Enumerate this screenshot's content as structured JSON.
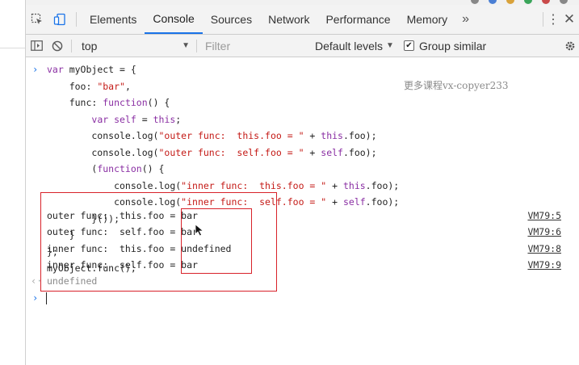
{
  "devtools": {
    "tabs": [
      {
        "label": "Elements",
        "active": false
      },
      {
        "label": "Console",
        "active": true
      },
      {
        "label": "Sources",
        "active": false
      },
      {
        "label": "Network",
        "active": false
      },
      {
        "label": "Performance",
        "active": false
      },
      {
        "label": "Memory",
        "active": false
      }
    ],
    "more_tabs_label": "»",
    "accent_color": "#1a73e8"
  },
  "toolbar": {
    "context": "top",
    "filter_placeholder": "Filter",
    "levels_label": "Default levels",
    "group_similar_label": "Group similar",
    "group_similar_checked": true
  },
  "console": {
    "code_lines": [
      "var myObject = {",
      "    foo: \"bar\",",
      "    func: function() {",
      "        var self = this;",
      "        console.log(\"outer func:  this.foo = \" + this.foo);",
      "        console.log(\"outer func:  self.foo = \" + self.foo);",
      "        (function() {",
      "            console.log(\"inner func:  this.foo = \" + this.foo);",
      "            console.log(\"inner func:  self.foo = \" + self.foo);",
      "        }());",
      "    }",
      "};",
      "myObject.func();"
    ],
    "output": [
      {
        "text": "outer func:  this.foo = ",
        "value": "bar",
        "source": "VM79:5"
      },
      {
        "text": "outer func:  self.foo = ",
        "value": "bar",
        "source": "VM79:6"
      },
      {
        "text": "inner func:  this.foo = ",
        "value": "undefined",
        "source": "VM79:8"
      },
      {
        "text": "inner func:  self.foo = ",
        "value": "bar",
        "source": "VM79:9"
      }
    ],
    "return_value": "undefined",
    "annotation_color": "#d8222a"
  },
  "watermark": "更多课程vx-copyer233"
}
